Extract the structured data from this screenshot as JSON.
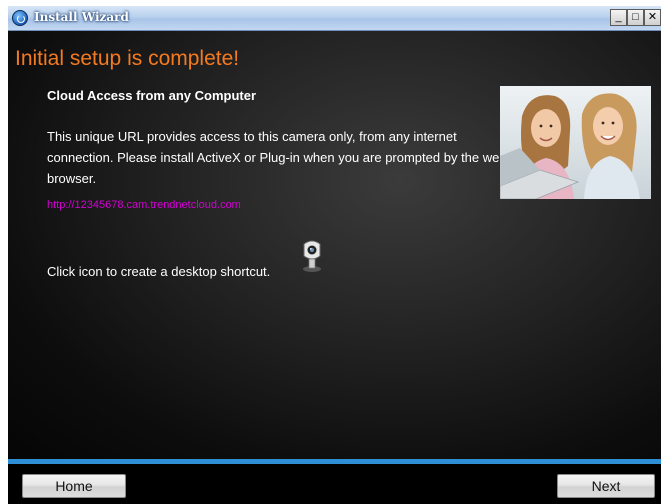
{
  "window": {
    "title": "Install Wizard",
    "controls": {
      "minimize": "_",
      "maximize": "□",
      "close": "✕"
    }
  },
  "main": {
    "heading": "Initial setup is complete!",
    "subheading": "Cloud Access from any Computer",
    "description": "This unique URL provides access to this camera only, from any internet connection. Please install ActiveX or Plug-in when you are prompted by the web browser.",
    "url": "http://12345678.cam.trendnetcloud.com",
    "shortcut_text": "Click icon to create a desktop shortcut.",
    "shortcut_icon": "shortcut-icon",
    "photo": "two-girls-at-laptop-photo"
  },
  "footer": {
    "home_label": "Home",
    "next_label": "Next"
  },
  "colors": {
    "heading": "#f47a20",
    "link": "#d400d4",
    "accent_bar": "#2f8fd6"
  }
}
